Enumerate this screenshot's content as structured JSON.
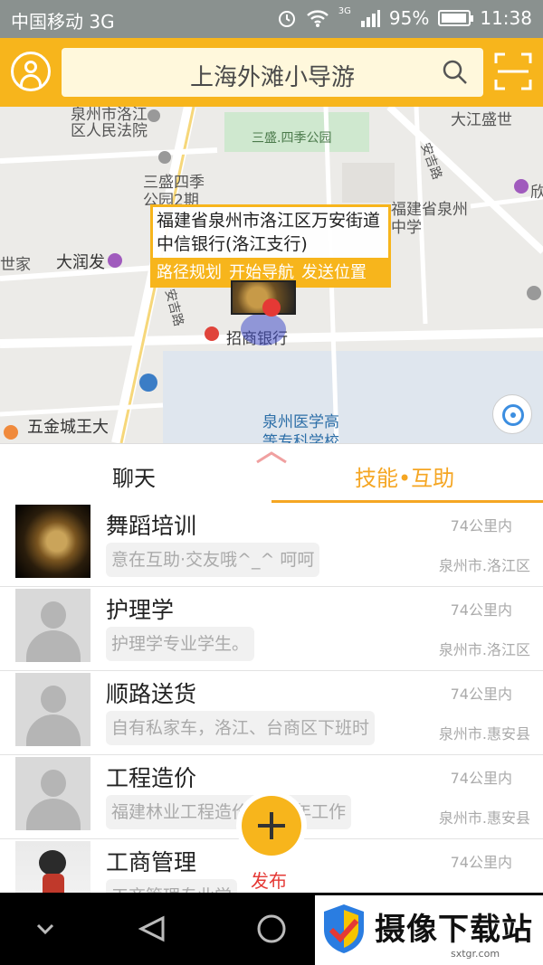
{
  "status_bar": {
    "carrier": "中国移动 3G",
    "network": "3G",
    "battery": "95%",
    "battery_level": 0.95,
    "time": "11:38"
  },
  "header": {
    "search_text": "上海外滩小导游"
  },
  "map": {
    "labels": {
      "court": "泉州市洛江\n区人民法院",
      "park": "三盛.四季公园",
      "sansheng": "三盛四季\n公园2期",
      "school": "福建省泉州\n中学",
      "shijia": "世家",
      "darunfa": "大润发",
      "anji": "安吉路",
      "anjing_road": "安吉路",
      "cmb": "招商银行",
      "wujin": "五金城王大",
      "medical": "泉州医学高\n等专科学校",
      "dajiang": "大江盛世",
      "right_edge": "欣"
    },
    "popup": {
      "address": "福建省泉州市洛江区万安街道中信银行(洛江支行)",
      "actions": [
        "路径规划",
        "开始导航",
        "发送位置"
      ]
    }
  },
  "tabs": {
    "chat": "聊天",
    "skills": "技能•互助"
  },
  "list": [
    {
      "title": "舞蹈培训",
      "distance": "74公里内",
      "desc": "意在互助·交友哦^_^ 呵呵",
      "location": "泉州市.洛江区",
      "thumb": "leopard"
    },
    {
      "title": "护理学",
      "distance": "74公里内",
      "desc": "护理学专业学生。",
      "location": "泉州市.洛江区",
      "thumb": "placeholder"
    },
    {
      "title": "顺路送货",
      "distance": "74公里内",
      "desc": "自有私家车，洛江、台商区下班时",
      "location": "泉州市.惠安县",
      "thumb": "placeholder"
    },
    {
      "title": "工程造价",
      "distance": "74公里内",
      "desc": "福建林业工程造价师，2年工作",
      "location": "泉州市.惠安县",
      "thumb": "placeholder"
    },
    {
      "title": "工商管理",
      "distance": "74公里内",
      "desc": "工商管理专业学",
      "location": "",
      "thumb": "figure"
    }
  ],
  "fab": {
    "label": "发布"
  },
  "watermark": {
    "name": "摄像下载站",
    "site": "sxtgr.com"
  },
  "colors": {
    "accent": "#f7b51c",
    "tab_active": "#f5a623",
    "publish_label": "#e53935"
  }
}
